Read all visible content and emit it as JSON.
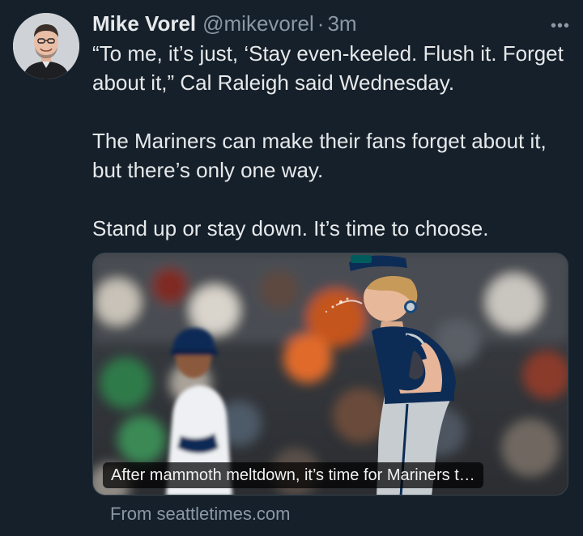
{
  "author": {
    "name": "Mike Vorel",
    "handle": "@mikevorel",
    "separator": "·",
    "time": "3m"
  },
  "more_icon": "more-horizontal-icon",
  "body": {
    "paragraphs": [
      "“To me, it’s just, ‘Stay even-keeled. Flush it. Forget about it,” Cal Raleigh said Wednesday.",
      "The Mariners can make their fans forget about it, but there’s only one way.",
      "Stand up or stay down. It’s time to choose."
    ]
  },
  "card": {
    "caption": "After mammoth meltdown, it’s time for Mariners t…",
    "source": "From seattletimes.com"
  },
  "colors": {
    "background": "#15202b",
    "text": "#e7e9ea",
    "secondary": "#8b98a5",
    "mariners_navy": "#0c2c56",
    "mariners_teal": "#005c5c"
  }
}
